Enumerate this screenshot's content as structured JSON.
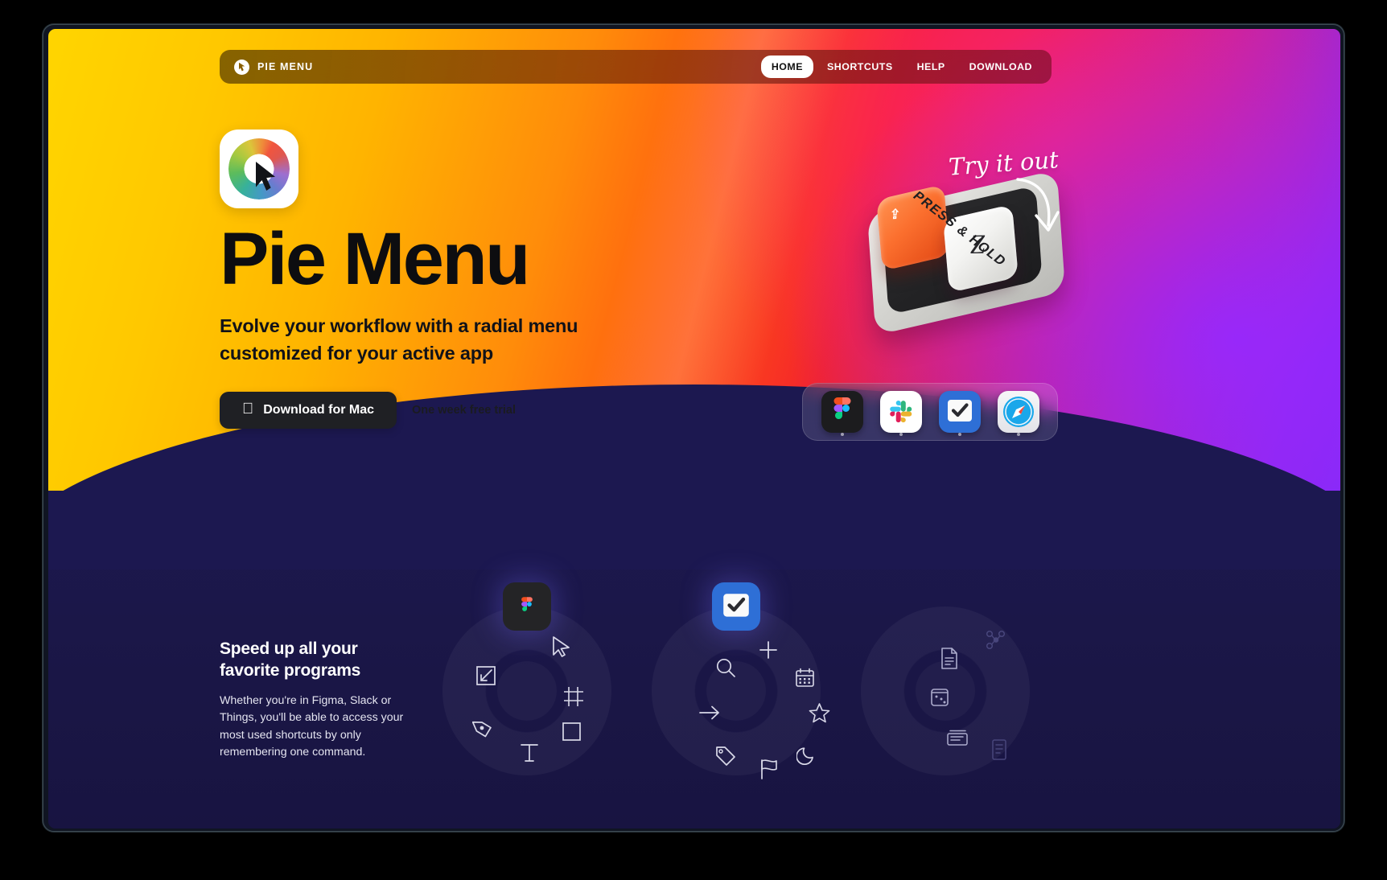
{
  "window": {
    "title": "Pie Menu"
  },
  "nav": {
    "brand": "PIE MENU",
    "brand_icon": "cursor-circle-logo",
    "links": [
      {
        "label": "HOME",
        "active": true
      },
      {
        "label": "SHORTCUTS",
        "active": false
      },
      {
        "label": "HELP",
        "active": false
      },
      {
        "label": "DOWNLOAD",
        "active": false
      }
    ]
  },
  "hero": {
    "app_icon": "color-wheel-cursor-icon",
    "title": "Pie Menu",
    "subtitle_line1": "Evolve your workflow with a radial menu",
    "subtitle_line2": "customized for your active app",
    "download_button": {
      "label": "Download for Mac",
      "icon": "apple-logo-icon"
    },
    "trial_note": "One week free trial",
    "annotation": "Try it out",
    "keyboard": {
      "base_label": "PRESS & HOLD",
      "shift_key_glyph": "⇪",
      "letter_key": "Z"
    },
    "dock": [
      {
        "name": "Figma",
        "icon": "figma-icon"
      },
      {
        "name": "Slack",
        "icon": "slack-icon"
      },
      {
        "name": "Things",
        "icon": "things-checkmark-icon"
      },
      {
        "name": "Safari",
        "icon": "safari-compass-icon"
      }
    ]
  },
  "feature": {
    "title_line1": "Speed up all your",
    "title_line2": "favorite programs",
    "body": "Whether you're in Figma, Slack or Things, you'll be able to access your most used shortcuts by only remembering one command."
  },
  "pie_menus": [
    {
      "app": "Figma",
      "app_icon": "figma-icon",
      "items": [
        {
          "icon": "cursor-arrow-icon",
          "angle": -55
        },
        {
          "icon": "scale-icon",
          "angle": -125
        },
        {
          "icon": "frame-icon",
          "angle": -10
        },
        {
          "icon": "pen-tool-icon",
          "angle": 175
        },
        {
          "icon": "text-tool-icon",
          "angle": 105
        },
        {
          "icon": "rectangle-icon",
          "angle": 42
        }
      ]
    },
    {
      "app": "Things",
      "app_icon": "things-checkmark-icon",
      "items": [
        {
          "icon": "plus-icon",
          "angle": -70
        },
        {
          "icon": "search-icon",
          "angle": -122
        },
        {
          "icon": "calendar-icon",
          "angle": -22
        },
        {
          "icon": "arrow-right-icon",
          "angle": 178
        },
        {
          "icon": "star-icon",
          "angle": -2
        },
        {
          "icon": "tag-icon",
          "angle": 140
        },
        {
          "icon": "flag-icon",
          "angle": 95
        },
        {
          "icon": "moon-icon",
          "angle": 50
        }
      ]
    },
    {
      "app": "",
      "app_icon": "",
      "items": [
        {
          "icon": "document-icon",
          "angle": -48
        },
        {
          "icon": "dice-icon",
          "angle": 8
        },
        {
          "icon": "card-stack-icon",
          "angle": 66
        },
        {
          "icon": "node-graph-icon",
          "angle": -88
        },
        {
          "icon": "page-icon",
          "angle": 112
        }
      ]
    }
  ],
  "colors": {
    "hero_start": "#ffd500",
    "hero_mid": "#f4232c",
    "hero_end": "#7a2bf5",
    "dark_section": "#1c1850",
    "cta_bg": "#1f2024",
    "things_blue": "#2e6fd6"
  }
}
